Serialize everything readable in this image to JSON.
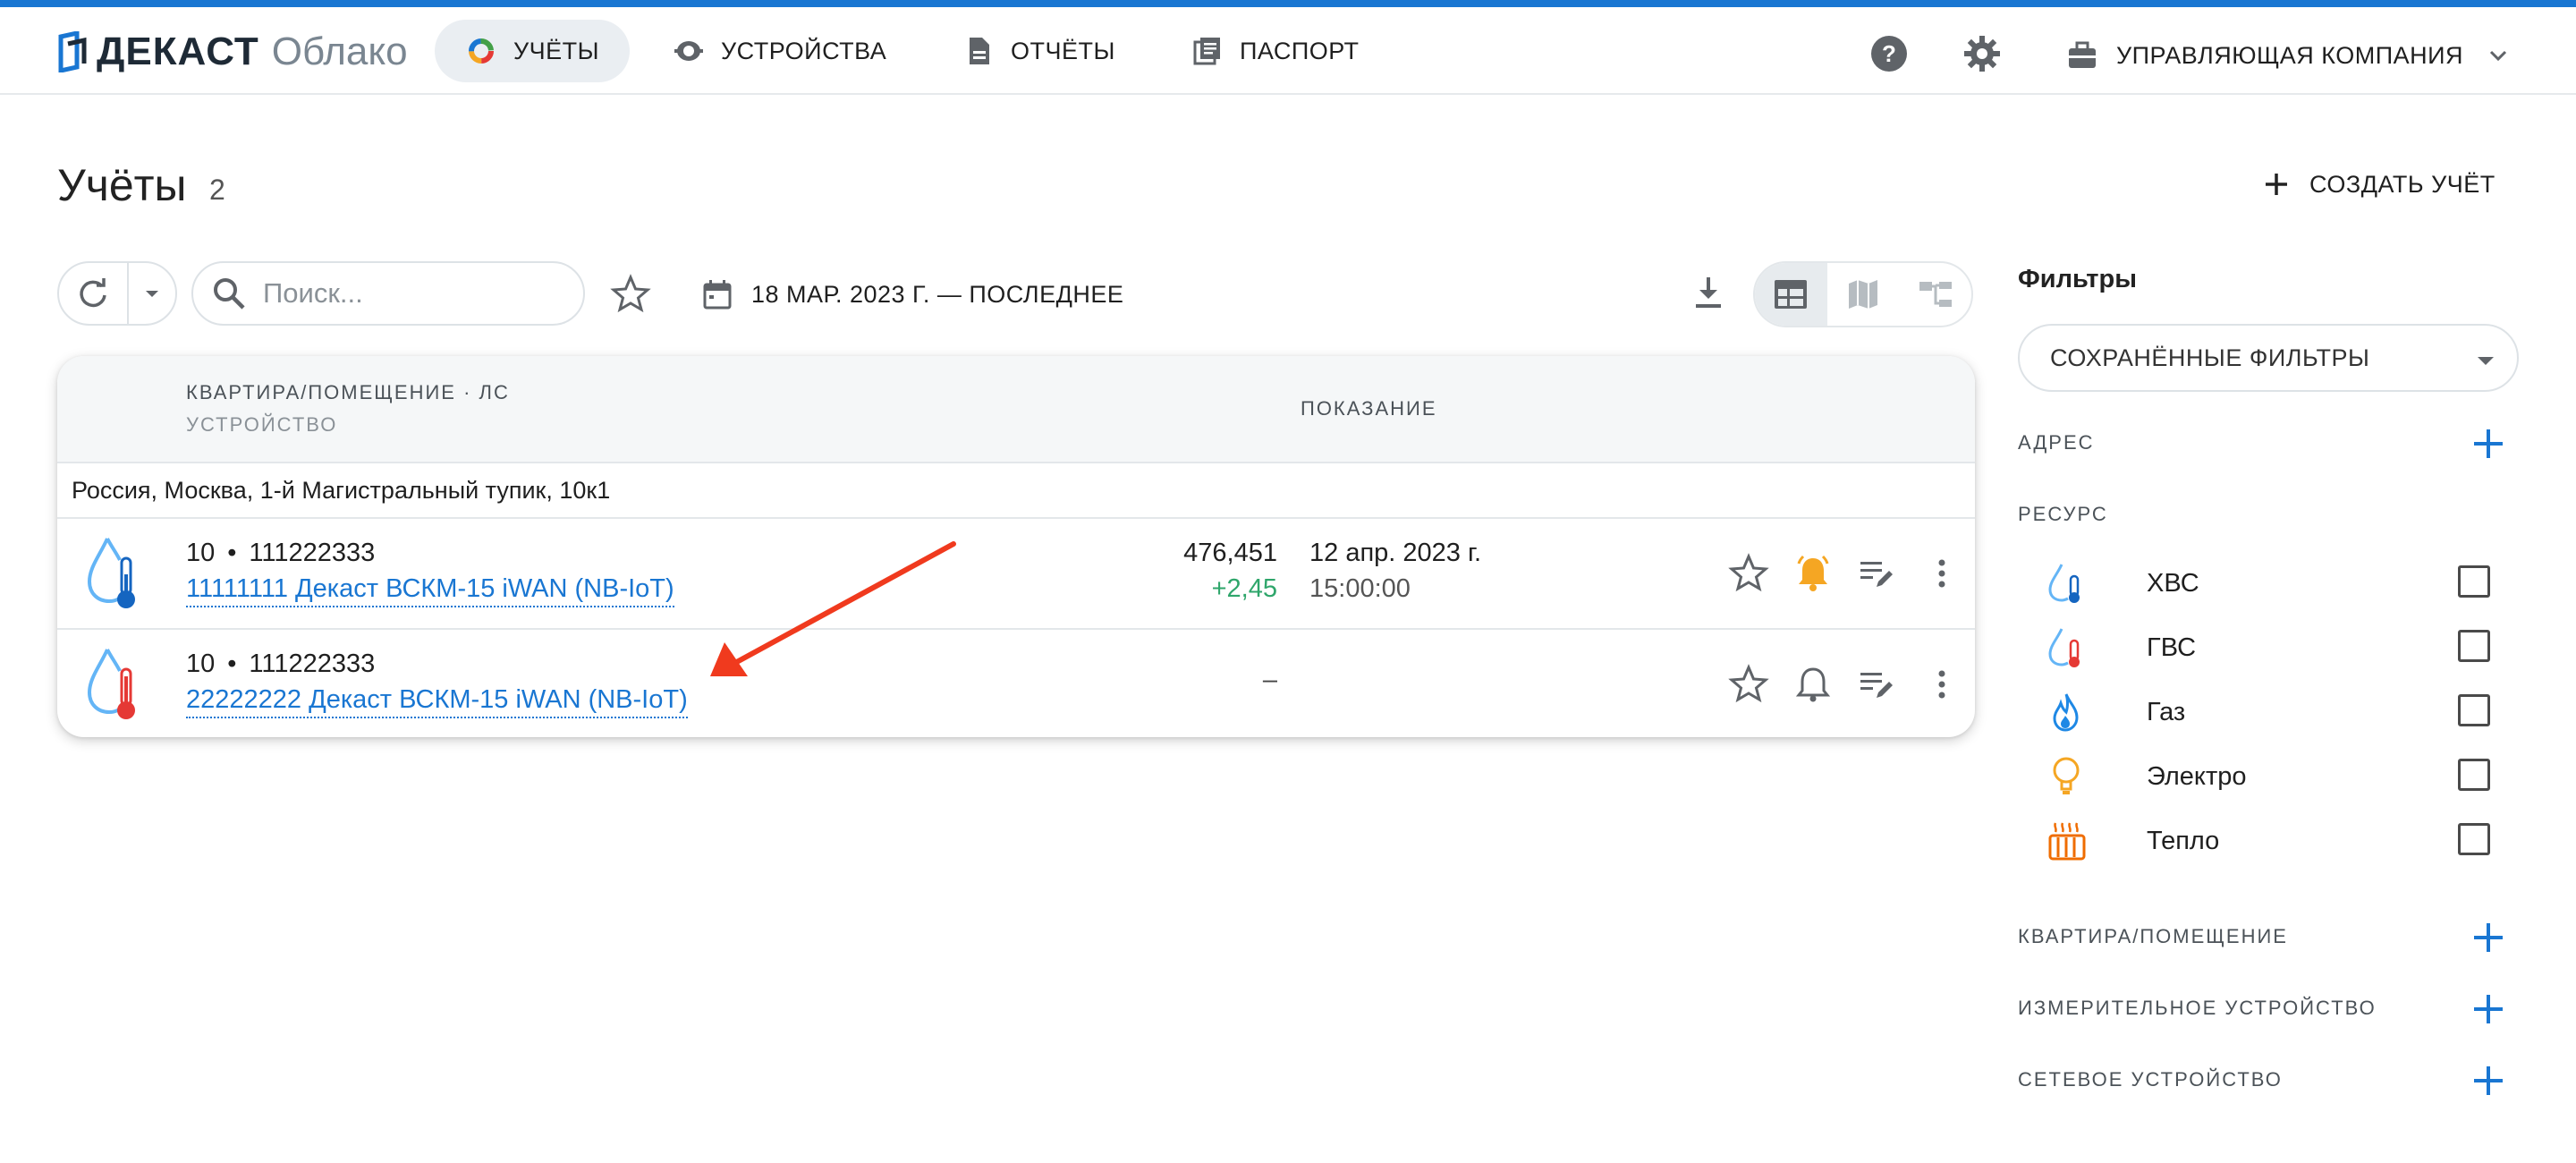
{
  "app": {
    "logo_word": "ДЕКАСТ",
    "logo_sub": "Облако"
  },
  "nav": {
    "items": [
      {
        "label": "УЧЁТЫ",
        "icon": "meters-ring-icon",
        "active": true
      },
      {
        "label": "УСТРОЙСТВА",
        "icon": "device-icon",
        "active": false
      },
      {
        "label": "ОТЧЁТЫ",
        "icon": "document-icon",
        "active": false
      },
      {
        "label": "ПАСПОРТ",
        "icon": "passport-icon",
        "active": false
      }
    ],
    "help_icon": "help-icon",
    "settings_icon": "gear-icon",
    "company_label": "УПРАВЛЯЮЩАЯ КОМПАНИЯ"
  },
  "page": {
    "title": "Учёты",
    "count": "2",
    "create_label": "СОЗДАТЬ УЧЁТ"
  },
  "toolbar": {
    "search_placeholder": "Поиск...",
    "date_range": "18 МАР. 2023 Г. — ПОСЛЕДНЕЕ"
  },
  "table": {
    "header": {
      "col1_line1": "КВАРТИРА/ПОМЕЩЕНИЕ · ЛС",
      "col1_line2": "УСТРОЙСТВО",
      "col2": "ПОКАЗАНИЕ"
    },
    "group": "Россия, Москва, 1-й Магистральный тупик, 10к1",
    "rows": [
      {
        "resource": "cold-water",
        "apartment": "10",
        "account": "111222333",
        "device": "11111111 Декаст ВСКМ-15 iWAN (NB-IoT)",
        "reading": "476,451",
        "delta": "+2,45",
        "date": "12 апр. 2023 г.",
        "time": "15:00:00",
        "alarm_active": true
      },
      {
        "resource": "hot-water",
        "apartment": "10",
        "account": "111222333",
        "device": "22222222 Декаст ВСКМ-15 iWAN (NB-IoT)",
        "reading": "–",
        "alarm_active": false
      }
    ]
  },
  "filters": {
    "title": "Фильтры",
    "saved": "СОХРАНЁННЫЕ ФИЛЬТРЫ",
    "address": "АДРЕС",
    "resource": "РЕСУРС",
    "resources": [
      {
        "label": "ХВС",
        "icon": "cold-water-icon",
        "checked": false
      },
      {
        "label": "ГВС",
        "icon": "hot-water-icon",
        "checked": false
      },
      {
        "label": "Газ",
        "icon": "gas-flame-icon",
        "checked": false
      },
      {
        "label": "Электро",
        "icon": "light-bulb-icon",
        "checked": false
      },
      {
        "label": "Тепло",
        "icon": "radiator-icon",
        "checked": false
      }
    ],
    "apartment": "КВАРТИРА/ПОМЕЩЕНИЕ",
    "meter_device": "ИЗМЕРИТЕЛЬНОЕ УСТРОЙСТВО",
    "network_device": "СЕТЕВОЕ УСТРОЙСТВО"
  },
  "colors": {
    "accent": "#1976d2",
    "alarm": "#f5a623",
    "delta_positive": "#2fa66b",
    "hot": "#e53935",
    "arrow": "#f03a1e"
  }
}
